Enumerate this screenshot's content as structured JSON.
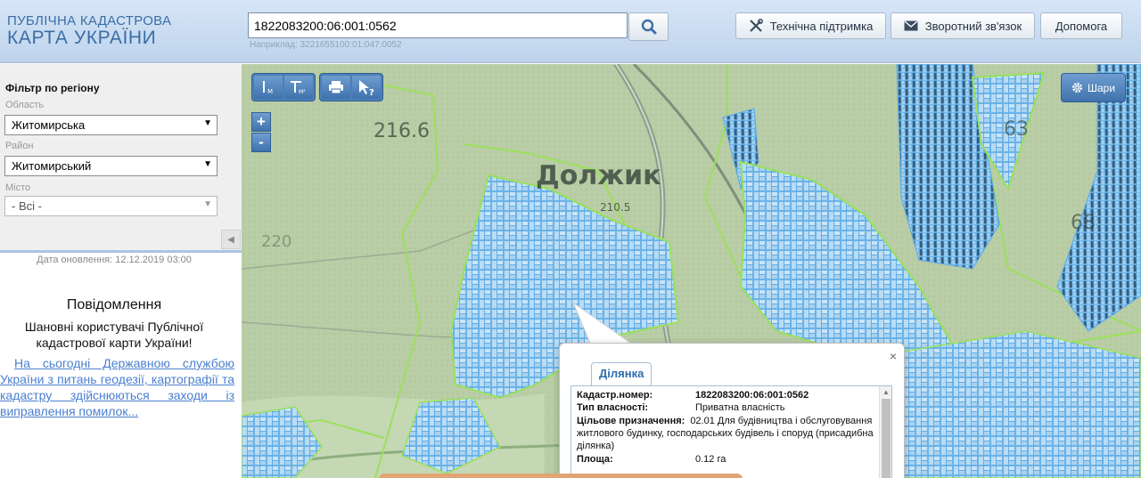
{
  "header": {
    "logo_line1": "ПУБЛІЧНА КАДАСТРОВА",
    "logo_line2": "КАРТА УКРАЇНИ",
    "search_value": "1822083200:06:001:0562",
    "search_hint": "Наприклад: 3221655100:01:047:0052",
    "support_label": "Технічна підтримка",
    "feedback_label": "Зворотний зв'язок",
    "help_label": "Допомога"
  },
  "sidebar": {
    "filter_title": "Фільтр по регіону",
    "oblast_label": "Область",
    "oblast_value": "Житомирська",
    "raion_label": "Район",
    "raion_value": "Житомирський",
    "city_label": "Місто",
    "city_value": "- Всі -",
    "update_date": "Дата оновлення: 12.12.2019 03:00",
    "notice_title": "Повідомлення",
    "notice_text": "Шановні користувачі Публічної кадастрової карти України!",
    "notice_link": "На сьогодні Державною службою України з питань геодезії, картографії та кадастру здійснюються заходи із виправлення помилок..."
  },
  "map": {
    "layers_label": "Шари",
    "zoom_in": "+",
    "zoom_out": "-",
    "labels": {
      "village": "Должик",
      "height1": "216.6",
      "height2": "210.5",
      "grid1": "63",
      "grid2": "68",
      "grid3": "220"
    }
  },
  "popup": {
    "tab_label": "Ділянка",
    "close": "×",
    "rows": [
      {
        "key": "Кадастр.номер:",
        "value": "1822083200:06:001:0562"
      },
      {
        "key": "Тип власності:",
        "value": "Приватна власність"
      },
      {
        "key": "Цільове призначення:",
        "value": "02.01 Для будівництва і обслуговування житлового будинку, господарських будівель і споруд (присадибна ділянка)"
      },
      {
        "key": "Площа:",
        "value": "0.12 га"
      }
    ]
  },
  "colors": {
    "header_bg": "#c8daf0",
    "logo": "#3a6ea5",
    "map_toolbar": "#4c7fb6",
    "parcel_fill": "#a8d4f2",
    "parcel_stroke": "#4aa3e6",
    "boundary": "#9be05a",
    "link": "#4a7fd0"
  }
}
